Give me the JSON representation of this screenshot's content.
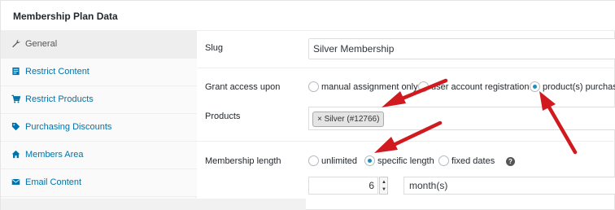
{
  "header": {
    "title": "Membership Plan Data"
  },
  "sidebar": {
    "items": [
      {
        "label": "General",
        "icon": "wrench-icon",
        "active": true
      },
      {
        "label": "Restrict Content",
        "icon": "document-icon"
      },
      {
        "label": "Restrict Products",
        "icon": "cart-icon"
      },
      {
        "label": "Purchasing Discounts",
        "icon": "tag-icon"
      },
      {
        "label": "Members Area",
        "icon": "home-icon"
      },
      {
        "label": "Email Content",
        "icon": "envelope-icon"
      }
    ]
  },
  "general": {
    "slug": {
      "label": "Slug",
      "value": "Silver Membership"
    },
    "grant_access": {
      "label": "Grant access upon",
      "options": [
        "manual assignment only",
        "user account registration",
        "product(s) purchase"
      ],
      "selected": "product(s) purchase"
    },
    "products": {
      "label": "Products",
      "chip_remove": "×",
      "chip_label": "Silver (#12766)"
    },
    "membership_length": {
      "label": "Membership length",
      "options": [
        "unlimited",
        "specific length",
        "fixed dates"
      ],
      "selected": "specific length",
      "help": "?",
      "amount": "6",
      "unit": "month(s)"
    }
  },
  "colors": {
    "accent": "#0073aa",
    "annotation_arrow": "#d11a1f",
    "radio_checked": "#1e8cbe"
  }
}
